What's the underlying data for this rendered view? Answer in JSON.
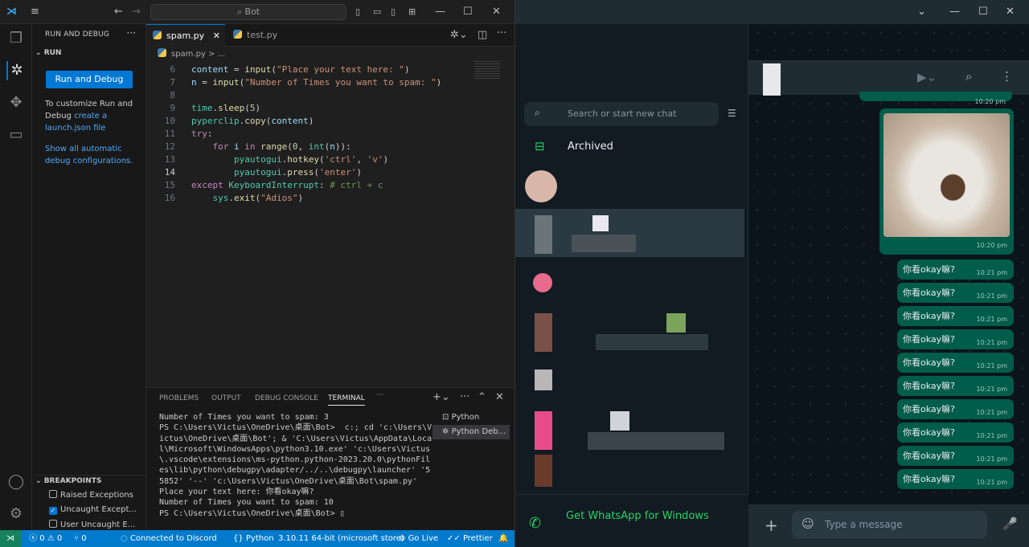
{
  "vscode": {
    "search_text": "Bot",
    "sidebar": {
      "title": "RUN AND DEBUG",
      "run_section": "RUN",
      "run_button": "Run and Debug",
      "customize_text": "To customize Run and Debug",
      "create_link": "create a launch.json file",
      "show_configs": "Show all automatic debug configurations.",
      "breakpoints_title": "BREAKPOINTS",
      "breakpoints": [
        {
          "label": "Raised Exceptions",
          "checked": false
        },
        {
          "label": "Uncaught Except...",
          "checked": true
        },
        {
          "label": "User Uncaught E...",
          "checked": false
        }
      ]
    },
    "tabs": [
      {
        "label": "spam.py",
        "active": true
      },
      {
        "label": "test.py",
        "active": false
      }
    ],
    "breadcrumb": "spam.py > ...",
    "code_lines": [
      {
        "n": "6"
      },
      {
        "n": "7"
      },
      {
        "n": "8"
      },
      {
        "n": "9"
      },
      {
        "n": "10"
      },
      {
        "n": "11"
      },
      {
        "n": "12"
      },
      {
        "n": "13"
      },
      {
        "n": "14"
      },
      {
        "n": "15"
      },
      {
        "n": "16"
      }
    ],
    "panel_tabs": [
      "PROBLEMS",
      "OUTPUT",
      "DEBUG CONSOLE",
      "TERMINAL"
    ],
    "terminal_text": "Number of Times you want to spam: 3\nPS C:\\Users\\Victus\\OneDrive\\桌面\\Bot>  c:; cd 'c:\\Users\\Victus\\OneDrive\\桌面\\Bot'; & 'C:\\Users\\Victus\\AppData\\Local\\Microsoft\\WindowsApps\\python3.10.exe' 'c:\\Users\\Victus\\.vscode\\extensions\\ms-python.python-2023.20.0\\pythonFiles\\lib\\python\\debugpy\\adapter/../..\\debugpy\\launcher' '55852' '--' 'c:\\Users\\Victus\\OneDrive\\桌面\\Bot\\spam.py'\nPlace your text here: 你看okay嘛?\nNumber of Times you want to spam: 10\nPS C:\\Users\\Victus\\OneDrive\\桌面\\Bot> ▯",
    "terminal_list": [
      "Python",
      "Python Deb..."
    ],
    "status": {
      "errors": "0",
      "warnings": "0",
      "ports": "0",
      "discord": "Connected to Discord",
      "language": "Python",
      "interpreter": "3.10.11 64-bit (microsoft store)",
      "golive": "Go Live",
      "prettier": "Prettier"
    }
  },
  "whatsapp": {
    "search_placeholder": "Search or start new chat",
    "archived": "Archived",
    "get_app": "Get WhatsApp for Windows",
    "image_time": "10:20 pm",
    "top_time": "10:20 pm",
    "message_placeholder": "Type a message",
    "messages": [
      {
        "text": "你看okay嘛?",
        "time": "10:21 pm"
      },
      {
        "text": "你看okay嘛?",
        "time": "10:21 pm"
      },
      {
        "text": "你看okay嘛?",
        "time": "10:21 pm"
      },
      {
        "text": "你看okay嘛?",
        "time": "10:21 pm"
      },
      {
        "text": "你看okay嘛?",
        "time": "10:21 pm"
      },
      {
        "text": "你看okay嘛?",
        "time": "10:21 pm"
      },
      {
        "text": "你看okay嘛?",
        "time": "10:21 pm"
      },
      {
        "text": "你看okay嘛?",
        "time": "10:21 pm"
      },
      {
        "text": "你看okay嘛?",
        "time": "10:21 pm"
      },
      {
        "text": "你看okay嘛?",
        "time": "10:21 pm"
      }
    ],
    "colors": {
      "bubble": "#005c4b",
      "accent": "#25d366",
      "panel": "#202c33"
    }
  }
}
